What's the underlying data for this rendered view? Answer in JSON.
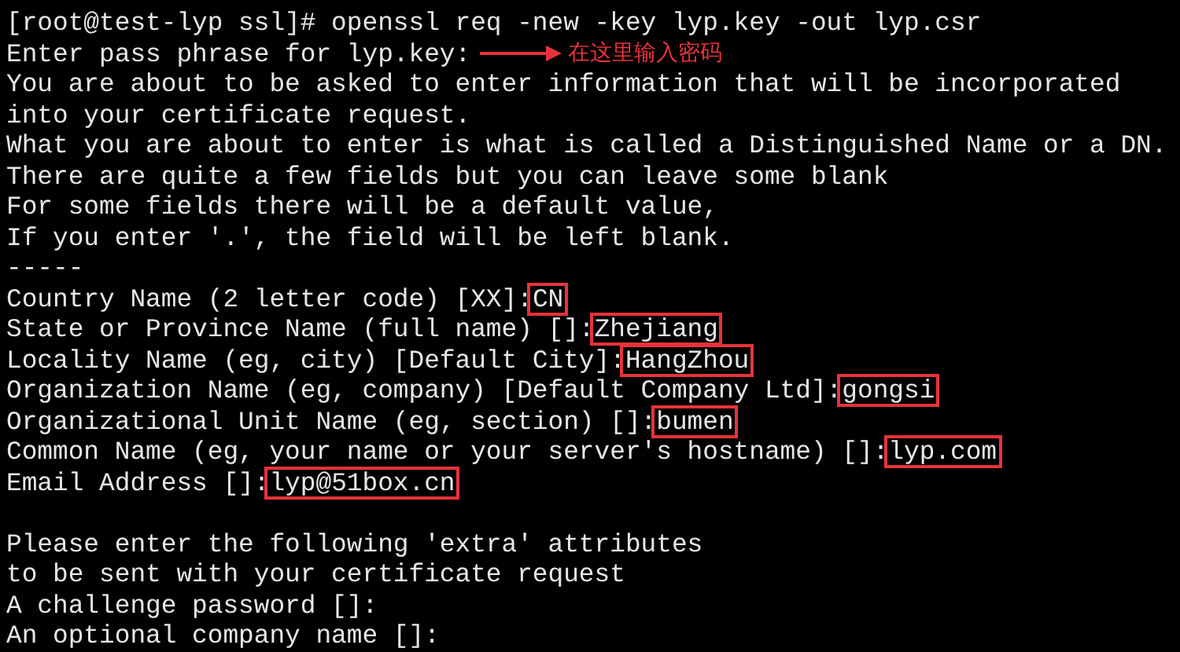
{
  "terminal": {
    "lines": [
      {
        "text": "[root@test-lyp ssl]# openssl req -new -key lyp.key -out lyp.csr"
      },
      {
        "text": "Enter pass phrase for lyp.key:",
        "annotation": "在这里输入密码"
      },
      {
        "text": "You are about to be asked to enter information that will be incorporated"
      },
      {
        "text": "into your certificate request."
      },
      {
        "text": "What you are about to enter is what is called a Distinguished Name or a DN."
      },
      {
        "text": "There are quite a few fields but you can leave some blank"
      },
      {
        "text": "For some fields there will be a default value,"
      },
      {
        "text": "If you enter '.', the field will be left blank."
      },
      {
        "text": "-----"
      },
      {
        "text": "Country Name (2 letter code) [XX]:",
        "answer": "CN"
      },
      {
        "text": "State or Province Name (full name) []:",
        "answer": "Zhejiang"
      },
      {
        "text": "Locality Name (eg, city) [Default City]:",
        "answer": "HangZhou"
      },
      {
        "text": "Organization Name (eg, company) [Default Company Ltd]:",
        "answer": "gongsi"
      },
      {
        "text": "Organizational Unit Name (eg, section) []:",
        "answer": "bumen"
      },
      {
        "text": "Common Name (eg, your name or your server's hostname) []:",
        "answer": "lyp.com"
      },
      {
        "text": "Email Address []:",
        "answer": "lyp@51box.cn"
      },
      {
        "text": "Please enter the following 'extra' attributes",
        "blank_line_before": true
      },
      {
        "text": "to be sent with your certificate request"
      },
      {
        "text": "A challenge password []:"
      },
      {
        "text": "An optional company name []:"
      }
    ]
  }
}
